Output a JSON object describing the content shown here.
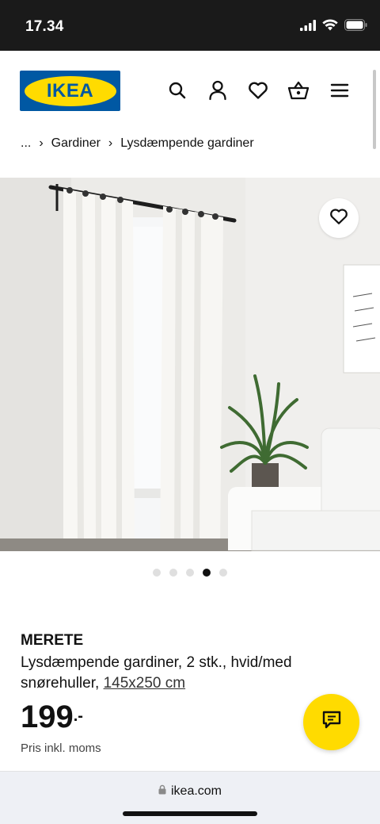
{
  "status_bar": {
    "time": "17.34",
    "icons": [
      "cellular-signal-icon",
      "wifi-icon",
      "battery-icon"
    ]
  },
  "header": {
    "logo_text": "IKEA",
    "icons": [
      "search-icon",
      "account-icon",
      "heart-icon",
      "basket-icon",
      "menu-icon"
    ]
  },
  "breadcrumb": {
    "items": [
      "...",
      "Gardiner",
      "Lysdæmpende gardiner"
    ],
    "separator": "›"
  },
  "gallery": {
    "dot_count": 5,
    "active_dot": 4,
    "favorite_icon": "heart-icon"
  },
  "product": {
    "name": "MERETE",
    "description": "Lysdæmpende gardiner, 2 stk., hvid/med snørehuller,",
    "measure": "145x250 cm",
    "price": "199",
    "price_suffix": ".-",
    "price_note": "Pris inkl. moms"
  },
  "chat": {
    "icon": "chat-icon"
  },
  "browser": {
    "url": "ikea.com",
    "lock_icon": "lock-icon"
  },
  "colors": {
    "ikea_blue": "#0058a3",
    "ikea_yellow": "#ffdb00",
    "status_bar": "#1a1a1a"
  }
}
